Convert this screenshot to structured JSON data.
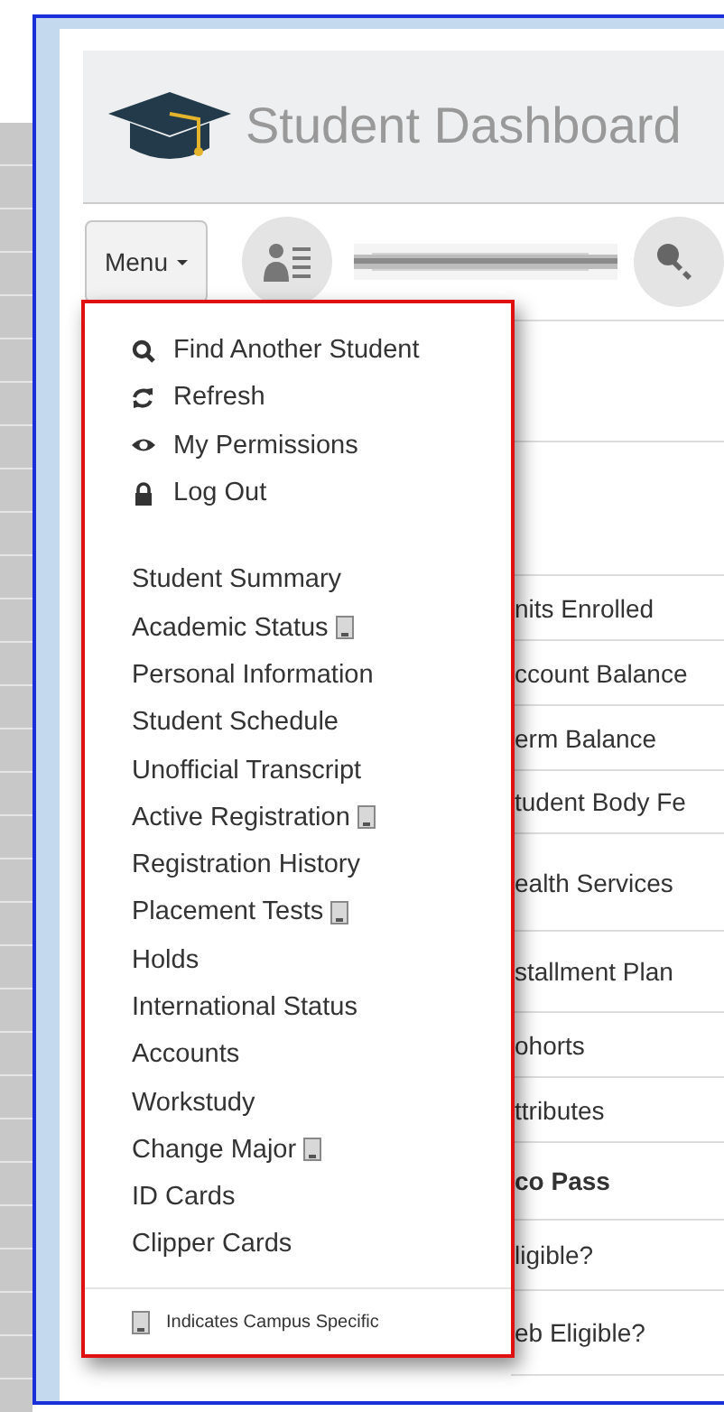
{
  "header": {
    "title": "Student Dashboard"
  },
  "toolbar": {
    "menu_button": "Menu"
  },
  "menu": {
    "actions": [
      {
        "label": "Find Another Student",
        "kind": "search"
      },
      {
        "label": "Refresh",
        "kind": "refresh"
      },
      {
        "label": "My Permissions",
        "kind": "eye"
      },
      {
        "label": "Log Out",
        "kind": "lock"
      }
    ],
    "items": [
      {
        "label": "Student Summary",
        "campus_specific": false
      },
      {
        "label": "Academic Status",
        "campus_specific": true
      },
      {
        "label": "Personal Information",
        "campus_specific": false
      },
      {
        "label": "Student Schedule",
        "campus_specific": false
      },
      {
        "label": "Unofficial Transcript",
        "campus_specific": false
      },
      {
        "label": "Active Registration",
        "campus_specific": true
      },
      {
        "label": "Registration History",
        "campus_specific": false
      },
      {
        "label": "Placement Tests",
        "campus_specific": true
      },
      {
        "label": "Holds",
        "campus_specific": false
      },
      {
        "label": "International Status",
        "campus_specific": false
      },
      {
        "label": "Accounts",
        "campus_specific": false
      },
      {
        "label": "Workstudy",
        "campus_specific": false
      },
      {
        "label": "Change Major",
        "campus_specific": true
      },
      {
        "label": "ID Cards",
        "campus_specific": false
      },
      {
        "label": "Clipper Cards",
        "campus_specific": false
      }
    ],
    "legend": "Indicates Campus Specific"
  },
  "table": {
    "rows": [
      {
        "label": "nits Enrolled",
        "bold": false
      },
      {
        "label": "ccount Balance",
        "bold": false
      },
      {
        "label": "erm Balance",
        "bold": false
      },
      {
        "label": "tudent Body Fe",
        "bold": false
      },
      {
        "label": "ealth Services",
        "bold": false
      },
      {
        "label": "stallment Plan",
        "bold": false
      },
      {
        "label": "ohorts",
        "bold": false
      },
      {
        "label": "ttributes",
        "bold": false
      },
      {
        "label": "co Pass",
        "bold": true
      },
      {
        "label": "ligible?",
        "bold": false
      },
      {
        "label": "eb Eligible?",
        "bold": false
      }
    ]
  }
}
